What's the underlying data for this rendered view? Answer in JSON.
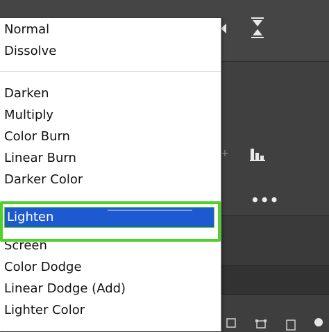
{
  "blend_menu": {
    "groups": [
      [
        "Normal",
        "Dissolve"
      ],
      [
        "Darken",
        "Multiply",
        "Color Burn",
        "Linear Burn",
        "Darker Color"
      ],
      [
        "Lighten",
        "Screen",
        "Color Dodge",
        "Linear Dodge (Add)",
        "Lighter Color"
      ]
    ],
    "selected": "Lighten"
  },
  "colors": {
    "selection_bg": "#1d59d1",
    "highlight_outline": "#4fd12a",
    "panel_bg": "#404040",
    "menu_bg": "#ffffff"
  },
  "icons": {
    "collapse": "arrow-left-icon",
    "hourglass": "hourglass-icon",
    "histogram": "histogram-icon",
    "more": "more-icon",
    "more_glyph": "•••"
  }
}
